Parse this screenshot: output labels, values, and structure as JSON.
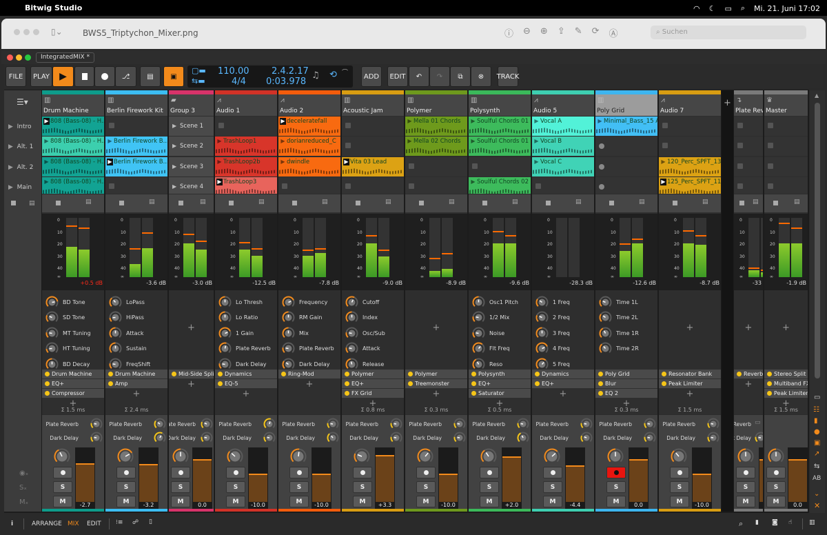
{
  "menubar": {
    "app": "Bitwig Studio",
    "datetime": "Mi. 21. Juni  17:02"
  },
  "preview": {
    "title": "BWS5_Triptychon_Mixer.png",
    "search_placeholder": "Suchen"
  },
  "window": {
    "tab": "IntegratedMIX *"
  },
  "toolbar": {
    "file": "FILE",
    "play": "PLAY",
    "add": "ADD",
    "edit": "EDIT",
    "track": "TRACK",
    "tempo": "110.00",
    "signature": "4/4",
    "position": "2.4.2.17",
    "time": "0:03.978"
  },
  "scenes": [
    "Intro",
    "Alt. 1",
    "Alt. 2",
    "Main"
  ],
  "colors": {
    "accent": "#f28a1b",
    "record": "#e8150f"
  },
  "meter_scale": [
    "0",
    "10",
    "20",
    "30",
    "40",
    "∞"
  ],
  "send_names": [
    "Plate Reverb",
    "Dark Delay"
  ],
  "buttons": {
    "solo": "S",
    "mute": "M"
  },
  "tracks": [
    {
      "name": "Drum Machine",
      "color": "#0e9c8b",
      "icon": "drum-icon",
      "clips": [
        {
          "name": "808 (Bass-08) - H...",
          "color": "#12a393",
          "playing": true
        },
        {
          "name": "808 (Bass-08) - H...",
          "color": "#3ccfae"
        },
        {
          "name": "808 (Bass-08) - H...",
          "color": "#12a393"
        },
        {
          "name": "808 (Bass-08) - H...",
          "color": "#12a393"
        }
      ],
      "meter": {
        "level": [
          -23,
          -25
        ],
        "peak_hold": [
          -6,
          -8
        ]
      },
      "peak": "+0.5 dB",
      "clipping": true,
      "params": [
        {
          "name": "BD Tone",
          "value": 0.8
        },
        {
          "name": "SD Tone",
          "value": 0.25
        },
        {
          "name": "MT Tuning",
          "value": 0.2
        },
        {
          "name": "HT Tuning",
          "value": 0.15
        },
        {
          "name": "BD Decay",
          "value": 0.5
        }
      ],
      "chain": [
        "Drum Machine",
        "EQ+",
        "Compressor"
      ],
      "latency": "Σ 1.5 ms",
      "sends": [
        0.2,
        0.2
      ],
      "pan": -0.2,
      "volume": "-2.7",
      "volume_db": -2.7,
      "armed": false
    },
    {
      "name": "Berlin Firework Kit",
      "color": "#3cbdf2",
      "icon": "drum-icon",
      "clips": [
        null,
        {
          "name": "Berlin Firework B...",
          "color": "#40c4f5"
        },
        {
          "name": "Berlin Firework B...",
          "color": "#40c4f5",
          "playing": true
        },
        null
      ],
      "meter": {
        "level": [
          -37,
          -24
        ],
        "peak_hold": [
          -25,
          -12
        ]
      },
      "peak": "-3.6 dB",
      "params": [
        {
          "name": "LoPass",
          "value": 0.35
        },
        {
          "name": "HiPass",
          "value": 0.15
        },
        {
          "name": "Attack",
          "value": 0.5
        },
        {
          "name": "Sustain",
          "value": 0.5
        },
        {
          "name": "FreqShift",
          "value": 0.2
        }
      ],
      "chain": [
        "Drum Machine",
        "Amp"
      ],
      "latency": "Σ 2.4 ms",
      "sends": [
        0.3,
        0.6
      ],
      "pan": 0.45,
      "volume": "-3.2",
      "volume_db": -3.2,
      "armed": false
    },
    {
      "name": "Group 3",
      "color": "#d8336a",
      "icon": "folder-icon",
      "group": true,
      "clips": [
        {
          "scene": "Scene 1"
        },
        {
          "scene": "Scene 2"
        },
        {
          "scene": "Scene 3"
        },
        {
          "scene": "Scene 4"
        }
      ],
      "meter": {
        "level": [
          -20,
          -25
        ],
        "peak_hold": [
          -13,
          -19
        ]
      },
      "peak": "-3.0 dB",
      "params": [],
      "chain": [
        "Mid-Side Split"
      ],
      "latency": "",
      "sends": [
        0.25,
        0.2
      ],
      "pan": 0,
      "volume": "0.0",
      "volume_db": 0,
      "armed": false
    },
    {
      "name": "Audio 1",
      "color": "#d23227",
      "icon": "waveform-icon",
      "clips": [
        null,
        {
          "name": "TrashLoop1",
          "color": "#d8352a"
        },
        {
          "name": "TrashLoop2b",
          "color": "#d8352a"
        },
        {
          "name": "TrashLoop3",
          "color": "#e8645c",
          "playing": true
        }
      ],
      "meter": {
        "level": [
          -25,
          -30
        ],
        "peak_hold": [
          -20,
          -25
        ]
      },
      "peak": "-12.5 dB",
      "params": [
        {
          "name": "Lo Thresh",
          "value": 0.5
        },
        {
          "name": "Lo Ratio",
          "value": 0.5
        },
        {
          "name": "1 Gain",
          "value": 0.75
        },
        {
          "name": "Plate Reverb",
          "value": 0.55
        },
        {
          "name": "Dark Delay",
          "value": 0.2
        }
      ],
      "chain": [
        "Dynamics",
        "EQ-5"
      ],
      "latency": "",
      "sends": [
        0.55,
        0.2
      ],
      "pan": -0.35,
      "volume": "-10.0",
      "volume_db": -10,
      "armed": false
    },
    {
      "name": "Audio 2",
      "color": "#f35c0c",
      "icon": "waveform-icon",
      "clips": [
        {
          "name": "deceleratefall",
          "color": "#f86a10",
          "playing": true
        },
        {
          "name": "dorianreduced_C",
          "color": "#f86a10"
        },
        {
          "name": "dwindle",
          "color": "#f86a10"
        },
        null
      ],
      "meter": {
        "level": [
          -30,
          -28
        ],
        "peak_hold": [
          -26,
          -25
        ]
      },
      "peak": "-7.8 dB",
      "params": [
        {
          "name": "Frequency",
          "value": 0.75
        },
        {
          "name": "RM Gain",
          "value": 0.5
        },
        {
          "name": "Mix",
          "value": 0.5
        },
        {
          "name": "Plate Reverb",
          "value": 0.2
        },
        {
          "name": "Dark Delay",
          "value": 0.3
        }
      ],
      "chain": [
        "Ring-Mod"
      ],
      "latency": "",
      "sends": [
        0.2,
        0.35
      ],
      "pan": 0.05,
      "volume": "-10.0",
      "volume_db": -10,
      "armed": false
    },
    {
      "name": "Acoustic Jam",
      "color": "#d89d12",
      "icon": "piano-icon",
      "clips": [
        null,
        null,
        {
          "name": "Vita 03 Lead",
          "color": "#dca214",
          "playing": true
        },
        null
      ],
      "meter": {
        "level": [
          -20,
          -31
        ],
        "peak_hold": [
          -14,
          -26
        ]
      },
      "peak": "-9.0 dB",
      "params": [
        {
          "name": "Cutoff",
          "value": 0.6
        },
        {
          "name": "Index",
          "value": 0.5
        },
        {
          "name": "Osc/Sub",
          "value": 0.2
        },
        {
          "name": "Attack",
          "value": 0.2
        },
        {
          "name": "Release",
          "value": 0.45
        }
      ],
      "chain": [
        "Polymer",
        "EQ+",
        "FX Grid"
      ],
      "latency": "Σ 0.8 ms",
      "sends": [
        0.2,
        0.2
      ],
      "pan": -0.5,
      "volume": "+3.3",
      "volume_db": 3.3,
      "armed": false
    },
    {
      "name": "Polymer",
      "color": "#6e991d",
      "icon": "piano-icon",
      "clips": [
        {
          "name": "Mella 01 Chords",
          "color": "#6e9a1c"
        },
        {
          "name": "Mella 02 Chords",
          "color": "#6e9a1c"
        },
        null,
        null
      ],
      "meter": {
        "level": [
          -43,
          -41
        ],
        "peak_hold": [
          -33,
          -29
        ]
      },
      "peak": "-8.9 dB",
      "params": [],
      "chain": [
        "Polymer",
        "Treemonster"
      ],
      "latency": "Σ 0.3 ms",
      "sends": [
        0.2,
        0.2
      ],
      "pan": 0.3,
      "volume": "-10.0",
      "volume_db": -10,
      "armed": false
    },
    {
      "name": "Polysynth",
      "color": "#3bb95a",
      "icon": "piano-icon",
      "clips": [
        {
          "name": "Soulful Chords 01 A",
          "color": "#3dbb5c"
        },
        {
          "name": "Soulful Chords 01 B",
          "color": "#3dbb5c"
        },
        null,
        {
          "name": "Soulful Chords 02 B",
          "color": "#3dbb5c"
        }
      ],
      "meter": {
        "level": [
          -20,
          -20
        ],
        "peak_hold": [
          -11,
          -14
        ]
      },
      "peak": "-9.6 dB",
      "params": [
        {
          "name": "Osc1 Pitch",
          "value": 0.5
        },
        {
          "name": "1/2 Mix",
          "value": 0.2
        },
        {
          "name": "Noise",
          "value": 0.2
        },
        {
          "name": "Flt Freq",
          "value": 0.65
        },
        {
          "name": "Reso",
          "value": 0.4
        }
      ],
      "chain": [
        "Polysynth",
        "EQ+",
        "Saturator"
      ],
      "latency": "Σ 0.5 ms",
      "sends": [
        0.2,
        0.4
      ],
      "pan": -0.25,
      "volume": "+2.0",
      "volume_db": 2,
      "armed": false
    },
    {
      "name": "Audio 5",
      "color": "#3ecfb1",
      "icon": "waveform-icon",
      "clips": [
        {
          "name": "Vocal A",
          "color": "#52f2d8"
        },
        {
          "name": "Vocal B",
          "color": "#40d3b6"
        },
        {
          "name": "Vocal C",
          "color": "#40d3b6"
        },
        null
      ],
      "meter": {
        "level": [
          -60,
          -60
        ],
        "peak_hold": [
          null,
          null
        ]
      },
      "peak": "-28.3 dB",
      "params": [
        {
          "name": "1 Freq",
          "value": 0.3
        },
        {
          "name": "2 Freq",
          "value": 0.25
        },
        {
          "name": "3 Freq",
          "value": 0.5
        },
        {
          "name": "4 Freq",
          "value": 0.75
        },
        {
          "name": "5 Freq",
          "value": 0.65
        }
      ],
      "chain": [
        "Dynamics",
        "EQ+"
      ],
      "latency": "",
      "sends": [
        0.2,
        0.25
      ],
      "pan": 0.35,
      "volume": "-4.4",
      "volume_db": -4.4,
      "armed": false
    },
    {
      "name": "Poly Grid",
      "color": "#3db5ef",
      "icon": "piano-icon",
      "selected": true,
      "clips": [
        {
          "name": "Minimal_Bass_15 A",
          "color": "#42bff5"
        },
        "rec",
        "rec",
        "rec"
      ],
      "meter": {
        "level": [
          -26,
          -20
        ],
        "peak_hold": [
          -21,
          -17
        ]
      },
      "peak": "-12.6 dB",
      "params": [
        {
          "name": "Time 1L",
          "value": 0.25
        },
        {
          "name": "Time 2L",
          "value": 0.3
        },
        {
          "name": "Time 1R",
          "value": 0.4
        },
        {
          "name": "Time 2R",
          "value": 0.35
        }
      ],
      "chain": [
        "Poly Grid",
        "Blur",
        "EQ 2"
      ],
      "latency": "Σ 0.3 ms",
      "sends": [
        0.2,
        0.2
      ],
      "pan": 0,
      "volume": "0.0",
      "volume_db": 0,
      "armed": true
    },
    {
      "name": "Audio 7",
      "color": "#d89d12",
      "icon": "waveform-icon",
      "clips": [
        null,
        null,
        {
          "name": "120_Perc_SPFT_13",
          "color": "#dca214"
        },
        {
          "name": "125_Perc_SPFT_11",
          "color": "#dca214",
          "playing": true
        }
      ],
      "meter": {
        "level": [
          -20,
          -21
        ],
        "peak_hold": [
          -10,
          -14
        ]
      },
      "peak": "-8.7 dB",
      "params": [],
      "chain": [
        "Resonator Bank",
        "Peak Limiter"
      ],
      "latency": "Σ 1.5 ms",
      "sends": [
        0.2,
        0.2
      ],
      "pan": -0.3,
      "volume": "-10.0",
      "volume_db": -10,
      "armed": false
    },
    {
      "name": "Plate Reve",
      "color": "#7a7a7a",
      "icon": "return-icon",
      "fx": true,
      "clips": [
        null,
        null,
        null,
        null
      ],
      "meter": {
        "level": [
          -42,
          -44
        ],
        "peak_hold": [
          -41,
          -43
        ]
      },
      "peak": "-33",
      "params": [],
      "chain": [
        "Reverb"
      ],
      "latency": "",
      "sends": [
        null,
        0.2
      ],
      "pan": 0,
      "volume": "",
      "volume_db": 0,
      "armed": false
    },
    {
      "name": "Master",
      "color": "#7a7a7a",
      "icon": "crown-icon",
      "master": true,
      "clips": [
        null,
        null,
        null,
        null
      ],
      "meter": {
        "level": [
          -20,
          -20
        ],
        "peak_hold": [
          -4,
          -8
        ]
      },
      "peak": "-1.9 dB",
      "params": [],
      "chain": [
        "Stereo Split",
        "Multiband FX-3",
        "Peak Limiter"
      ],
      "latency": "Σ 1.5 ms",
      "sends": [],
      "pan": 0,
      "volume": "0.0",
      "volume_db": 0,
      "armed": false
    }
  ],
  "bottombar": {
    "arrange": "ARRANGE",
    "mix": "MIX",
    "edit": "EDIT",
    "info": "i"
  }
}
